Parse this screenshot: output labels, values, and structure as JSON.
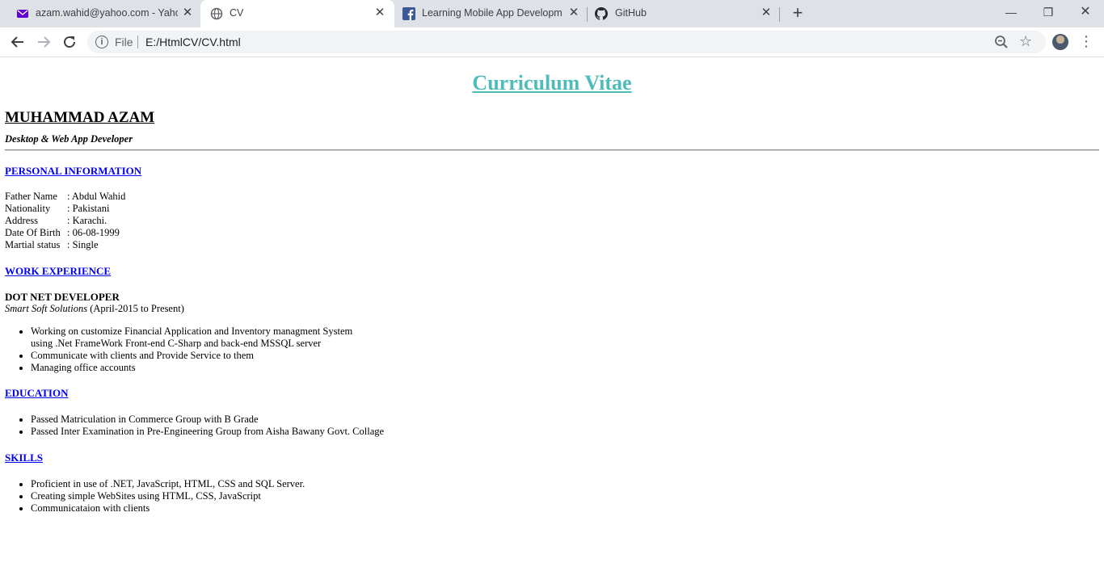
{
  "browser": {
    "tabs": [
      {
        "title": "azam.wahid@yahoo.com - Yahoo",
        "icon": "yahoo-mail-icon",
        "active": false
      },
      {
        "title": "CV",
        "icon": "globe-icon",
        "active": true
      },
      {
        "title": "Learning Mobile App Developme",
        "icon": "facebook-icon",
        "active": false
      },
      {
        "title": "GitHub",
        "icon": "github-icon",
        "active": false
      }
    ],
    "new_tab_symbol": "+",
    "omnibox": {
      "scheme_chip": "File",
      "url": "E:/HtmlCV/CV.html"
    },
    "window_controls": {
      "minimize": "—",
      "restore": "❐",
      "close": "✕"
    }
  },
  "cv": {
    "heading": "Curriculum Vitae",
    "name": "MUHAMMAD AZAM",
    "role": "Desktop & Web App Developer",
    "personal": {
      "heading": "PERSONAL INFORMATION",
      "rows": [
        {
          "label": "Father Name",
          "value": ": Abdul Wahid"
        },
        {
          "label": "Nationality",
          "value": ": Pakistani"
        },
        {
          "label": "Address",
          "value": ": Karachi."
        },
        {
          "label": "Date Of Birth",
          "value": ": 06-08-1999"
        },
        {
          "label": "Martial status",
          "value": ": Single"
        }
      ]
    },
    "work": {
      "heading": "WORK EXPERIENCE",
      "job_title": "DOT NET DEVELOPER",
      "company": "Smart Soft Solutions",
      "period": "(April-2015 to Present)",
      "items": [
        "Working on customize Financial Application and Inventory managment System",
        "using .Net FrameWork Front-end C-Sharp and back-end MSSQL server",
        "Communicate with clients and Provide Service to them",
        "Managing office accounts"
      ]
    },
    "education": {
      "heading": "EDUCATION",
      "items": [
        "Passed Matriculation in Commerce Group with B Grade",
        "Passed Inter Examination in Pre-Engineering Group from Aisha Bawany Govt. Collage"
      ]
    },
    "skills": {
      "heading": "SKILLS",
      "items": [
        "Proficient in use of .NET, JavaScript, HTML, CSS and SQL Server.",
        "Creating simple WebSites using HTML, CSS, JavaScript",
        "Communicataion with clients"
      ]
    }
  }
}
